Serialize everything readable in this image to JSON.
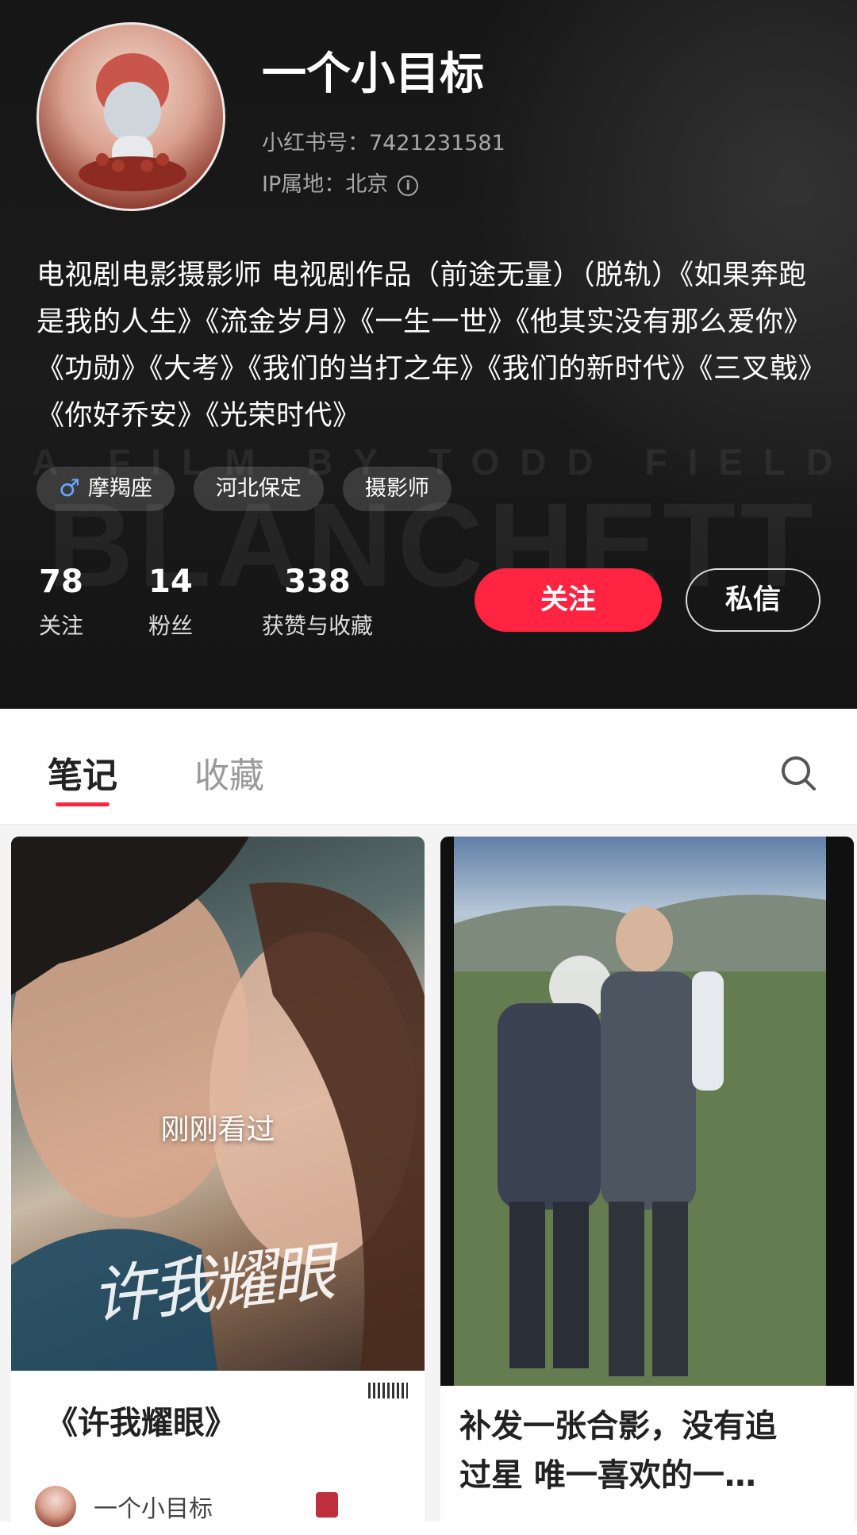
{
  "profile": {
    "username": "一个小目标",
    "id_line": "小红书号：7421231581",
    "ip_line": "IP属地：北京",
    "bio": "电视剧电影摄影师 电视剧作品（前途无量）（脱轨）《如果奔跑是我的人生》《流金岁月》《一生一世》《他其实没有那么爱你》《功勋》《大考》《我们的当打之年》《我们的新时代》《三叉戟》《你好乔安》《光荣时代》",
    "tags": [
      "摩羯座",
      "河北保定",
      "摄影师"
    ],
    "gender_symbol": "♂",
    "stats": [
      {
        "value": "78",
        "label": "关注"
      },
      {
        "value": "14",
        "label": "粉丝"
      },
      {
        "value": "338",
        "label": "获赞与收藏"
      }
    ],
    "follow_label": "关注",
    "message_label": "私信",
    "background_watermark_1": "A FILM BY TODD FIELD",
    "background_watermark_2": "BLANCHETT"
  },
  "tabs": {
    "notes": "笔记",
    "favorites": "收藏",
    "active": "笔记"
  },
  "notes": [
    {
      "title": "《许我耀眼》",
      "overlay": "刚刚看过",
      "image_text": "许我耀眼",
      "author": "一个小目标"
    },
    {
      "title_line1": "补发一张合影，没有追",
      "title_line2": "过星   唯一喜欢的一…"
    }
  ],
  "colors": {
    "accent": "#ff2442",
    "header_bg": "#1a1a1a",
    "tag_bg": "rgba(255,255,255,0.15)"
  },
  "icons": [
    "info-icon",
    "male-icon",
    "search-icon",
    "like-icon"
  ]
}
